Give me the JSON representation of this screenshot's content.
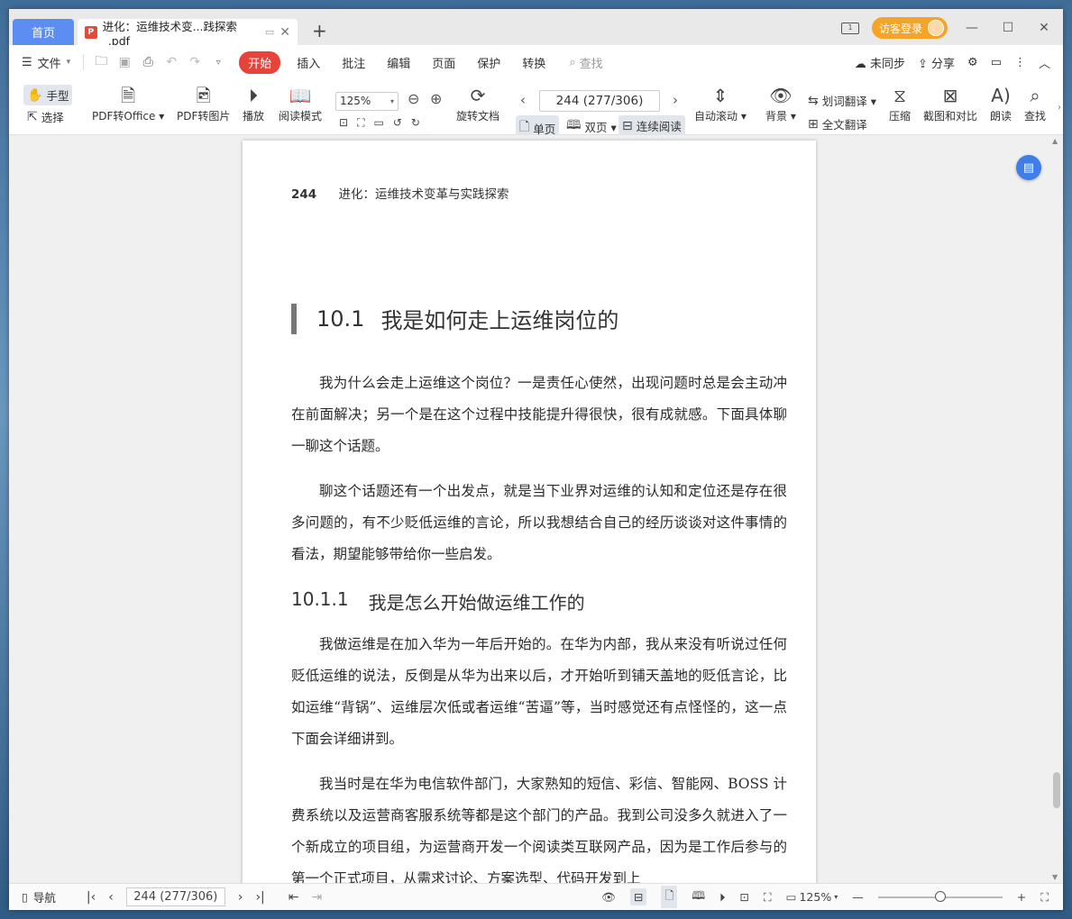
{
  "titlebar": {
    "home_tab": "首页",
    "doc_tab": "进化：运维技术变...践探索_.pdf",
    "login_label": "访客登录"
  },
  "menu": {
    "file": "文件",
    "start": "开始",
    "tabs": [
      "插入",
      "批注",
      "编辑",
      "页面",
      "保护",
      "转换"
    ],
    "search_placeholder": "查找",
    "sync": "未同步",
    "share": "分享"
  },
  "ribbon": {
    "hand_tool": "手型",
    "select_tool": "选择",
    "pdf_to_office": "PDF转Office",
    "pdf_to_image": "PDF转图片",
    "play": "播放",
    "read_mode": "阅读模式",
    "zoom": "125%",
    "page_indicator": "244 (277/306)",
    "rotate": "旋转文档",
    "single_page": "单页",
    "double_page": "双页",
    "continuous": "连续阅读",
    "auto_scroll": "自动滚动",
    "background": "背景",
    "word_translate": "划词翻译",
    "full_translate": "全文翻译",
    "compress": "压缩",
    "screenshot_compare": "截图和对比",
    "read_aloud": "朗读",
    "find": "查找"
  },
  "page": {
    "running_number": "244",
    "running_title": "进化：运维技术变革与实践探索",
    "section_num": "10.1",
    "section_title": "我是如何走上运维岗位的",
    "p1": "我为什么会走上运维这个岗位？一是责任心使然，出现问题时总是会主动冲在前面解决；另一个是在这个过程中技能提升得很快，很有成就感。下面具体聊一聊这个话题。",
    "p2": "聊这个话题还有一个出发点，就是当下业界对运维的认知和定位还是存在很多问题的，有不少贬低运维的言论，所以我想结合自己的经历谈谈对这件事情的看法，期望能够带给你一些启发。",
    "subsection_num": "10.1.1",
    "subsection_title": "我是怎么开始做运维工作的",
    "p3": "我做运维是在加入华为一年后开始的。在华为内部，我从来没有听说过任何贬低运维的说法，反倒是从华为出来以后，才开始听到铺天盖地的贬低言论，比如运维“背锅”、运维层次低或者运维“苦逼”等，当时感觉还有点怪怪的，这一点下面会详细讲到。",
    "p4": "我当时是在华为电信软件部门，大家熟知的短信、彩信、智能网、BOSS 计费系统以及运营商客服系统等都是这个部门的产品。我到公司没多久就进入了一个新成立的项目组，为运营商开发一个阅读类互联网产品，因为是工作后参与的第一个正式项目，从需求讨论、方案选型、代码开发到上"
  },
  "status": {
    "nav_label": "导航",
    "page_indicator": "244 (277/306)",
    "zoom": "125%",
    "zoom_slider_fraction": 0.5
  }
}
